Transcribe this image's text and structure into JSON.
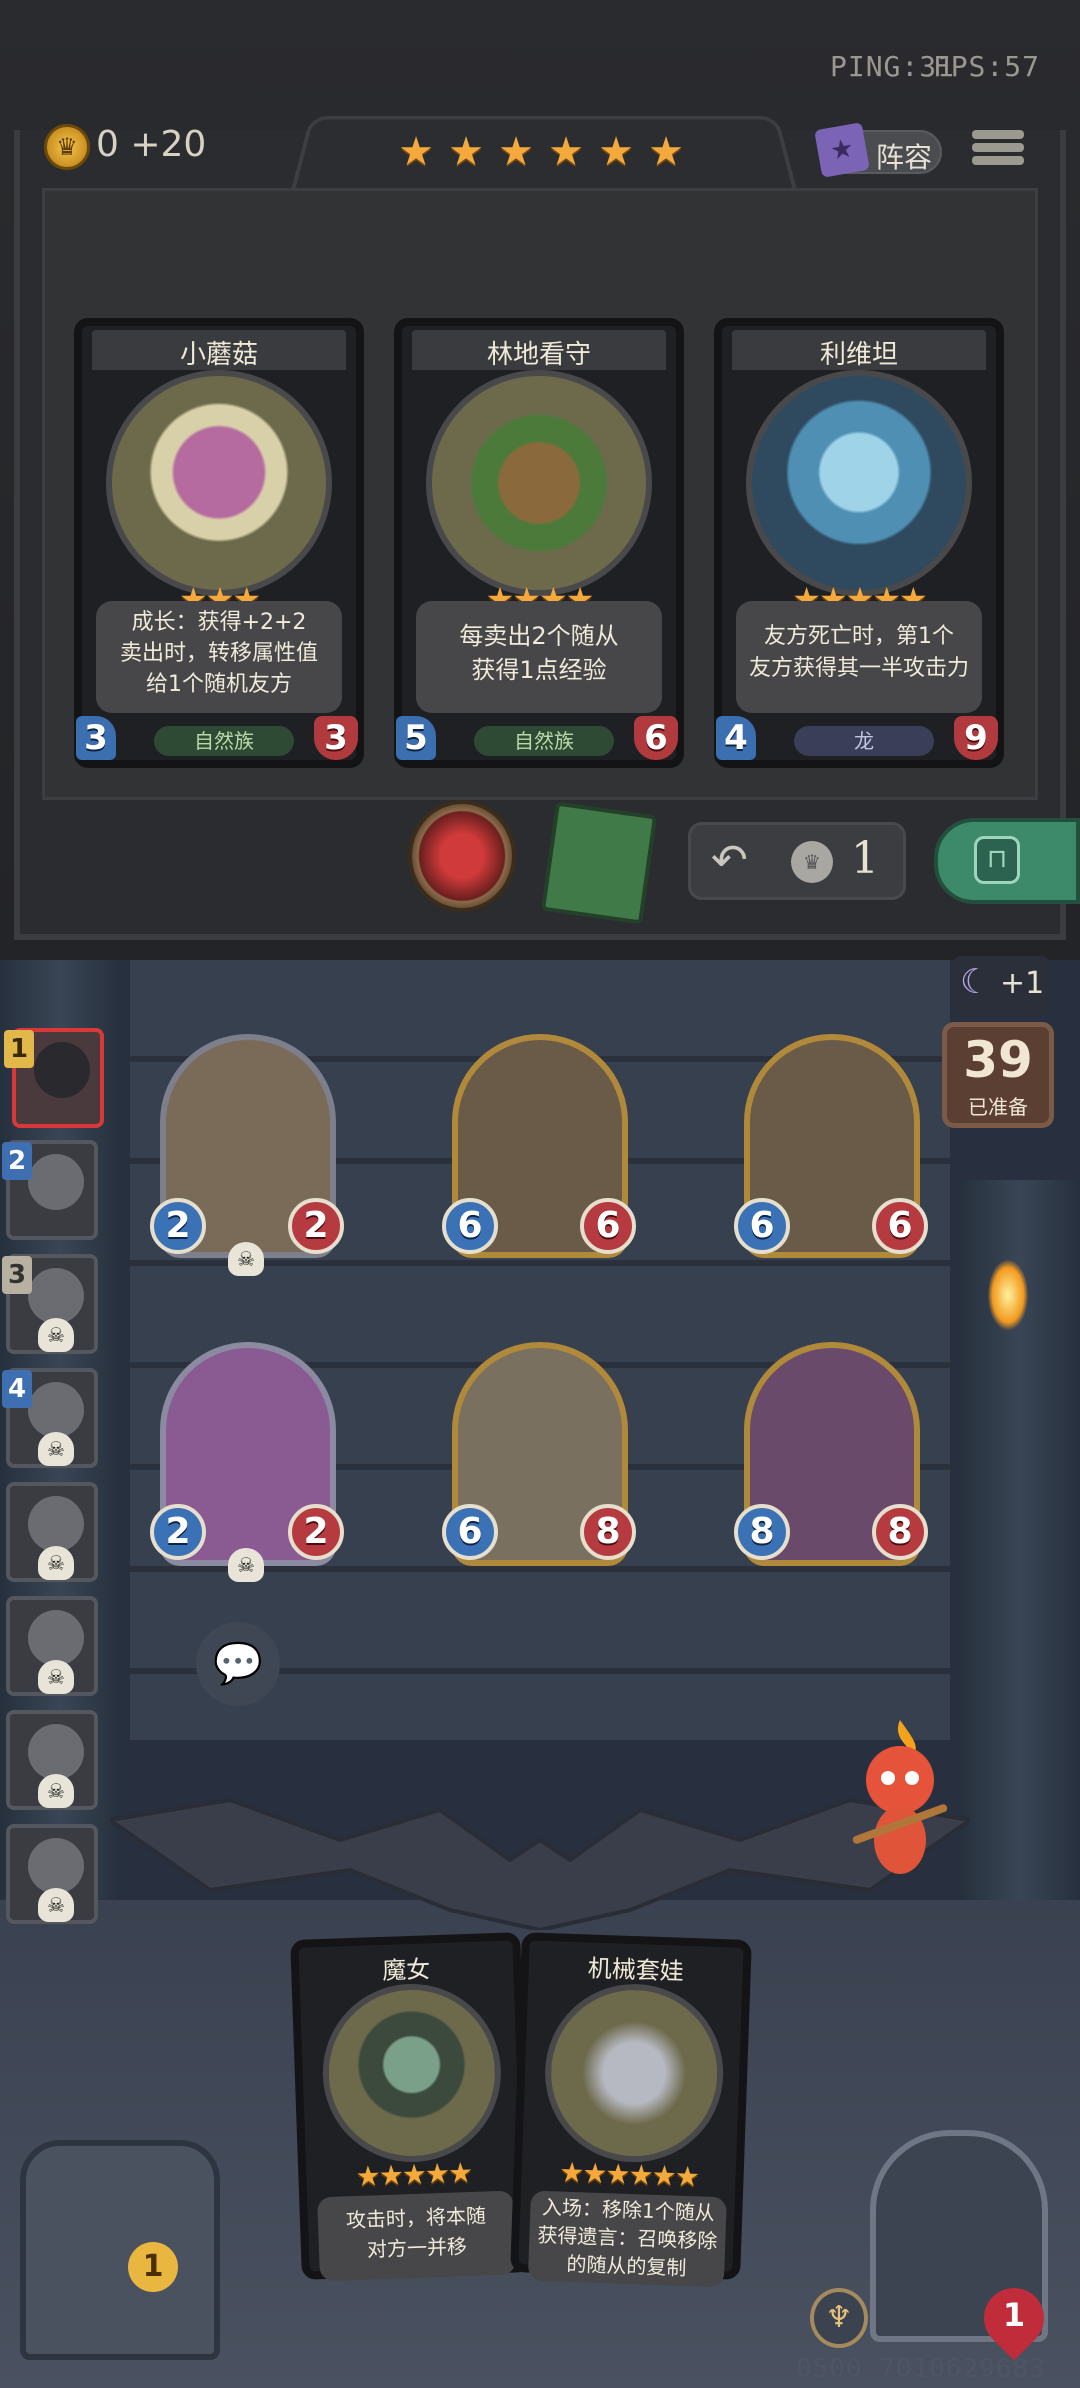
{
  "status": {
    "ping": "PING:31",
    "fps": "FPS:57"
  },
  "gold": {
    "text": "0 +20"
  },
  "tier_stars": [
    "★",
    "★",
    "★",
    "★",
    "★",
    "★"
  ],
  "lineup": {
    "label": "阵容"
  },
  "shop_cards": [
    {
      "name": "小蘑菇",
      "stars": "★★★",
      "desc_lines": [
        "成长：获得+2+2",
        "卖出时，转移属性值",
        "给1个随机友方"
      ],
      "attack": "3",
      "health": "3",
      "tribe": "自然族"
    },
    {
      "name": "林地看守",
      "stars": "★★★★",
      "desc_lines": [
        "每卖出2个随从",
        "获得1点经验"
      ],
      "attack": "5",
      "health": "6",
      "tribe": "自然族"
    },
    {
      "name": "利维坦",
      "stars": "★★★★★",
      "desc_lines": [
        "友方死亡时，第1个",
        "友方获得其一半攻击力"
      ],
      "attack": "4",
      "health": "9",
      "tribe": "龙"
    }
  ],
  "refresh": {
    "cost": "1"
  },
  "turn": {
    "moon_bonus": "+1",
    "timer": "39",
    "timer_label": "已准备"
  },
  "roster": [
    {
      "rank": "1"
    },
    {
      "rank": "2"
    },
    {
      "rank": "3"
    },
    {
      "rank": "4"
    },
    {
      "rank": ""
    },
    {
      "rank": ""
    },
    {
      "rank": ""
    },
    {
      "rank": ""
    }
  ],
  "board": [
    {
      "attack": "2",
      "health": "2"
    },
    {
      "attack": "6",
      "health": "6"
    },
    {
      "attack": "6",
      "health": "6"
    },
    {
      "attack": "2",
      "health": "2"
    },
    {
      "attack": "6",
      "health": "8"
    },
    {
      "attack": "8",
      "health": "8"
    }
  ],
  "hand": [
    {
      "name": "魔女",
      "desc_lines": [
        "攻击时，将本随",
        "对方一并移"
      ]
    },
    {
      "name": "机械套娃",
      "desc_lines": [
        "入场：移除1个随从",
        "获得遗言：召唤移除",
        "的随从的复制"
      ]
    }
  ],
  "barrel": {
    "count": "1"
  },
  "hero": {
    "health": "1"
  },
  "footer": {
    "uid": "0500 7010629683"
  },
  "colors": {
    "gold_star": "#f4a93c",
    "attack_blue": "#3b72b5",
    "health_red": "#b53b40"
  }
}
